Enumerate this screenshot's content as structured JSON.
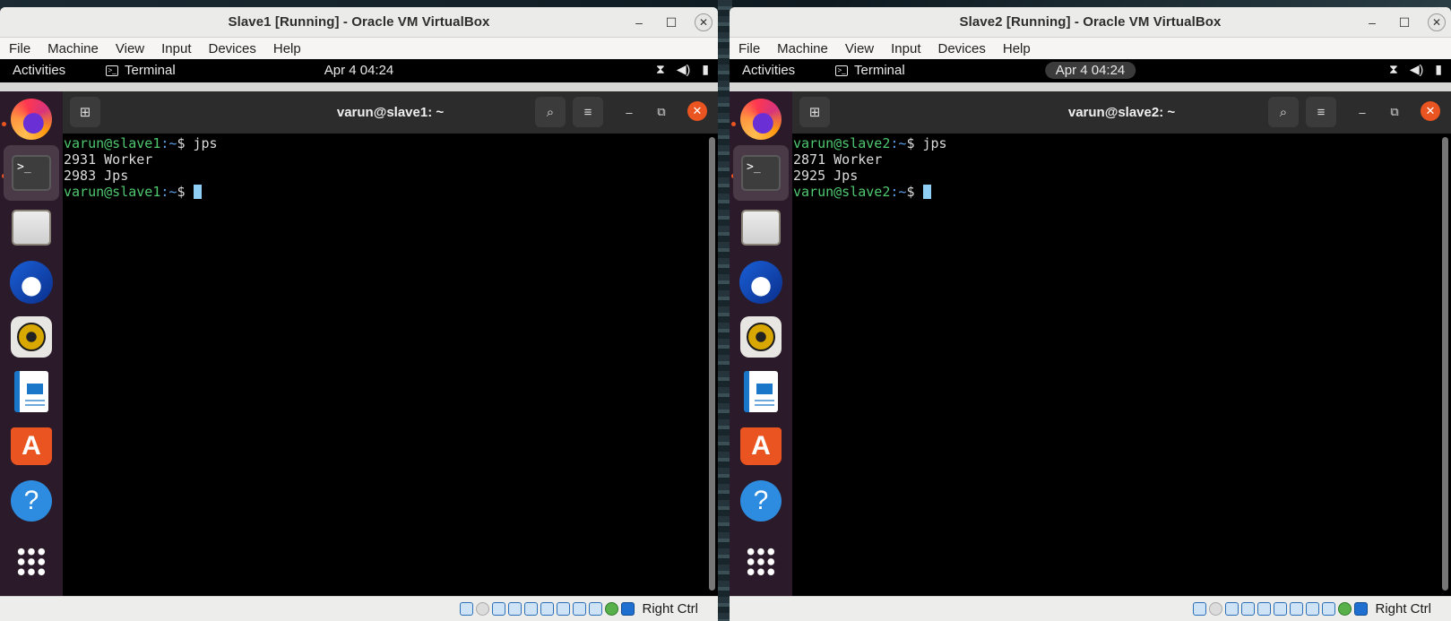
{
  "vms": [
    {
      "title": "Slave1 [Running] - Oracle VM VirtualBox",
      "menu": [
        "File",
        "Machine",
        "View",
        "Input",
        "Devices",
        "Help"
      ],
      "gnome": {
        "activities": "Activities",
        "app": "Terminal",
        "clock": "Apr 4  04:24"
      },
      "terminal": {
        "title": "varun@slave1: ~",
        "prompt_user": "varun@slave1",
        "prompt_path": ":~",
        "prompt_symbol": "$ ",
        "command": "jps",
        "output": [
          "2931 Worker",
          "2983 Jps"
        ]
      },
      "host_key": "Right Ctrl"
    },
    {
      "title": "Slave2 [Running] - Oracle VM VirtualBox",
      "menu": [
        "File",
        "Machine",
        "View",
        "Input",
        "Devices",
        "Help"
      ],
      "gnome": {
        "activities": "Activities",
        "app": "Terminal",
        "clock": "Apr 4  04:24"
      },
      "terminal": {
        "title": "varun@slave2: ~",
        "prompt_user": "varun@slave2",
        "prompt_path": ":~",
        "prompt_symbol": "$ ",
        "command": "jps",
        "output": [
          "2871 Worker",
          "2925 Jps"
        ]
      },
      "host_key": "Right Ctrl"
    }
  ],
  "dock_apps": [
    "firefox-icon",
    "terminal-icon",
    "files-icon",
    "thunderbird-icon",
    "rhythmbox-icon",
    "libreoffice-writer-icon",
    "app-center-icon",
    "help-icon",
    "show-apps-icon"
  ],
  "colors": {
    "ubuntu_orange": "#e95420",
    "prompt_green": "#4fc870",
    "prompt_blue": "#5aa0e8",
    "dock_bg": "#2b1b2a"
  }
}
